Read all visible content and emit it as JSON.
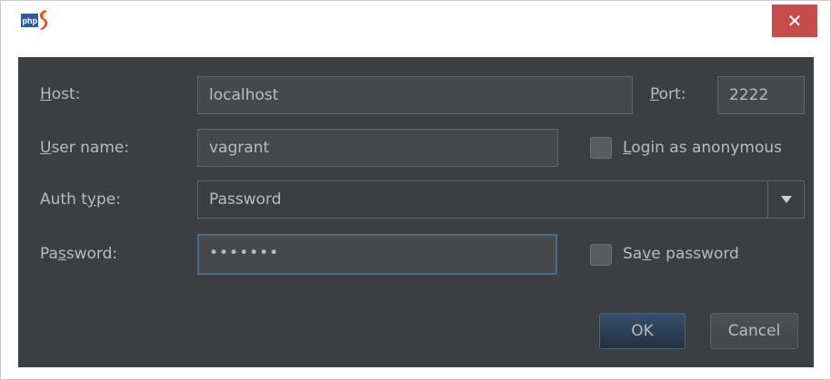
{
  "window": {
    "app_icon": "php-storm-icon",
    "close_label": "✕"
  },
  "form": {
    "host": {
      "label_pre": "",
      "label_u": "H",
      "label_post": "ost:",
      "value": "localhost"
    },
    "port": {
      "label_pre": "",
      "label_u": "P",
      "label_post": "ort:",
      "value": "2222"
    },
    "username": {
      "label_pre": "",
      "label_u": "U",
      "label_post": "ser name:",
      "value": "vagrant"
    },
    "anonymous": {
      "label_pre": "",
      "label_u": "L",
      "label_post": "ogin as anonymous",
      "checked": false
    },
    "auth_type": {
      "label_pre": "Auth t",
      "label_u": "y",
      "label_post": "pe:",
      "selected": "Password"
    },
    "password": {
      "label_pre": "Pa",
      "label_u": "s",
      "label_post": "sword:",
      "masked_value": "•••••••"
    },
    "save_password": {
      "label_pre": "Sa",
      "label_u": "v",
      "label_post": "e password",
      "checked": false
    }
  },
  "buttons": {
    "ok_label": "OK",
    "cancel_label": "Cancel"
  },
  "colors": {
    "panel_bg": "#3c3f41",
    "close_bg": "#c94c4c",
    "focus_border": "#466d94"
  }
}
